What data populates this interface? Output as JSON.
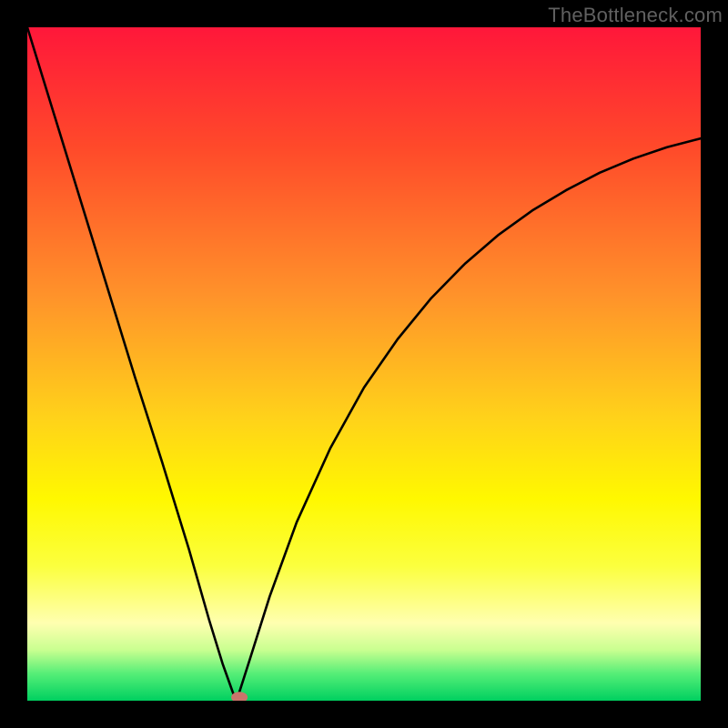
{
  "watermark": {
    "text": "TheBottleneck.com"
  },
  "chart_data": {
    "type": "line",
    "title": "",
    "xlabel": "",
    "ylabel": "",
    "xlim": [
      0,
      100
    ],
    "ylim": [
      0,
      100
    ],
    "grid": false,
    "minimum": {
      "x": 31,
      "y": 0
    },
    "marker": {
      "x": 31.5,
      "y": 0.5,
      "color": "#c9756b",
      "rx": 9,
      "ry": 6
    },
    "series": [
      {
        "name": "bottleneck-curve",
        "color": "#000000",
        "width": 2.6,
        "x": [
          0,
          4,
          8,
          12,
          16,
          20,
          24,
          27,
          29,
          30.5,
          31,
          31.5,
          33,
          36,
          40,
          45,
          50,
          55,
          60,
          65,
          70,
          75,
          80,
          85,
          90,
          95,
          100
        ],
        "values": [
          100,
          87,
          74,
          61,
          48,
          35.5,
          22.5,
          12,
          5.5,
          1.3,
          0,
          1.3,
          6.0,
          15.5,
          26.5,
          37.5,
          46.5,
          53.7,
          59.8,
          64.9,
          69.2,
          72.8,
          75.8,
          78.4,
          80.5,
          82.2,
          83.5
        ]
      }
    ],
    "gradient_stops": [
      {
        "offset": 0.0,
        "color": "#ff173a"
      },
      {
        "offset": 0.18,
        "color": "#ff4a2a"
      },
      {
        "offset": 0.4,
        "color": "#ff932a"
      },
      {
        "offset": 0.58,
        "color": "#ffd21a"
      },
      {
        "offset": 0.7,
        "color": "#fff800"
      },
      {
        "offset": 0.8,
        "color": "#fbff3e"
      },
      {
        "offset": 0.885,
        "color": "#ffffb0"
      },
      {
        "offset": 0.925,
        "color": "#c8ff90"
      },
      {
        "offset": 0.96,
        "color": "#55ee77"
      },
      {
        "offset": 1.0,
        "color": "#00d060"
      }
    ]
  }
}
